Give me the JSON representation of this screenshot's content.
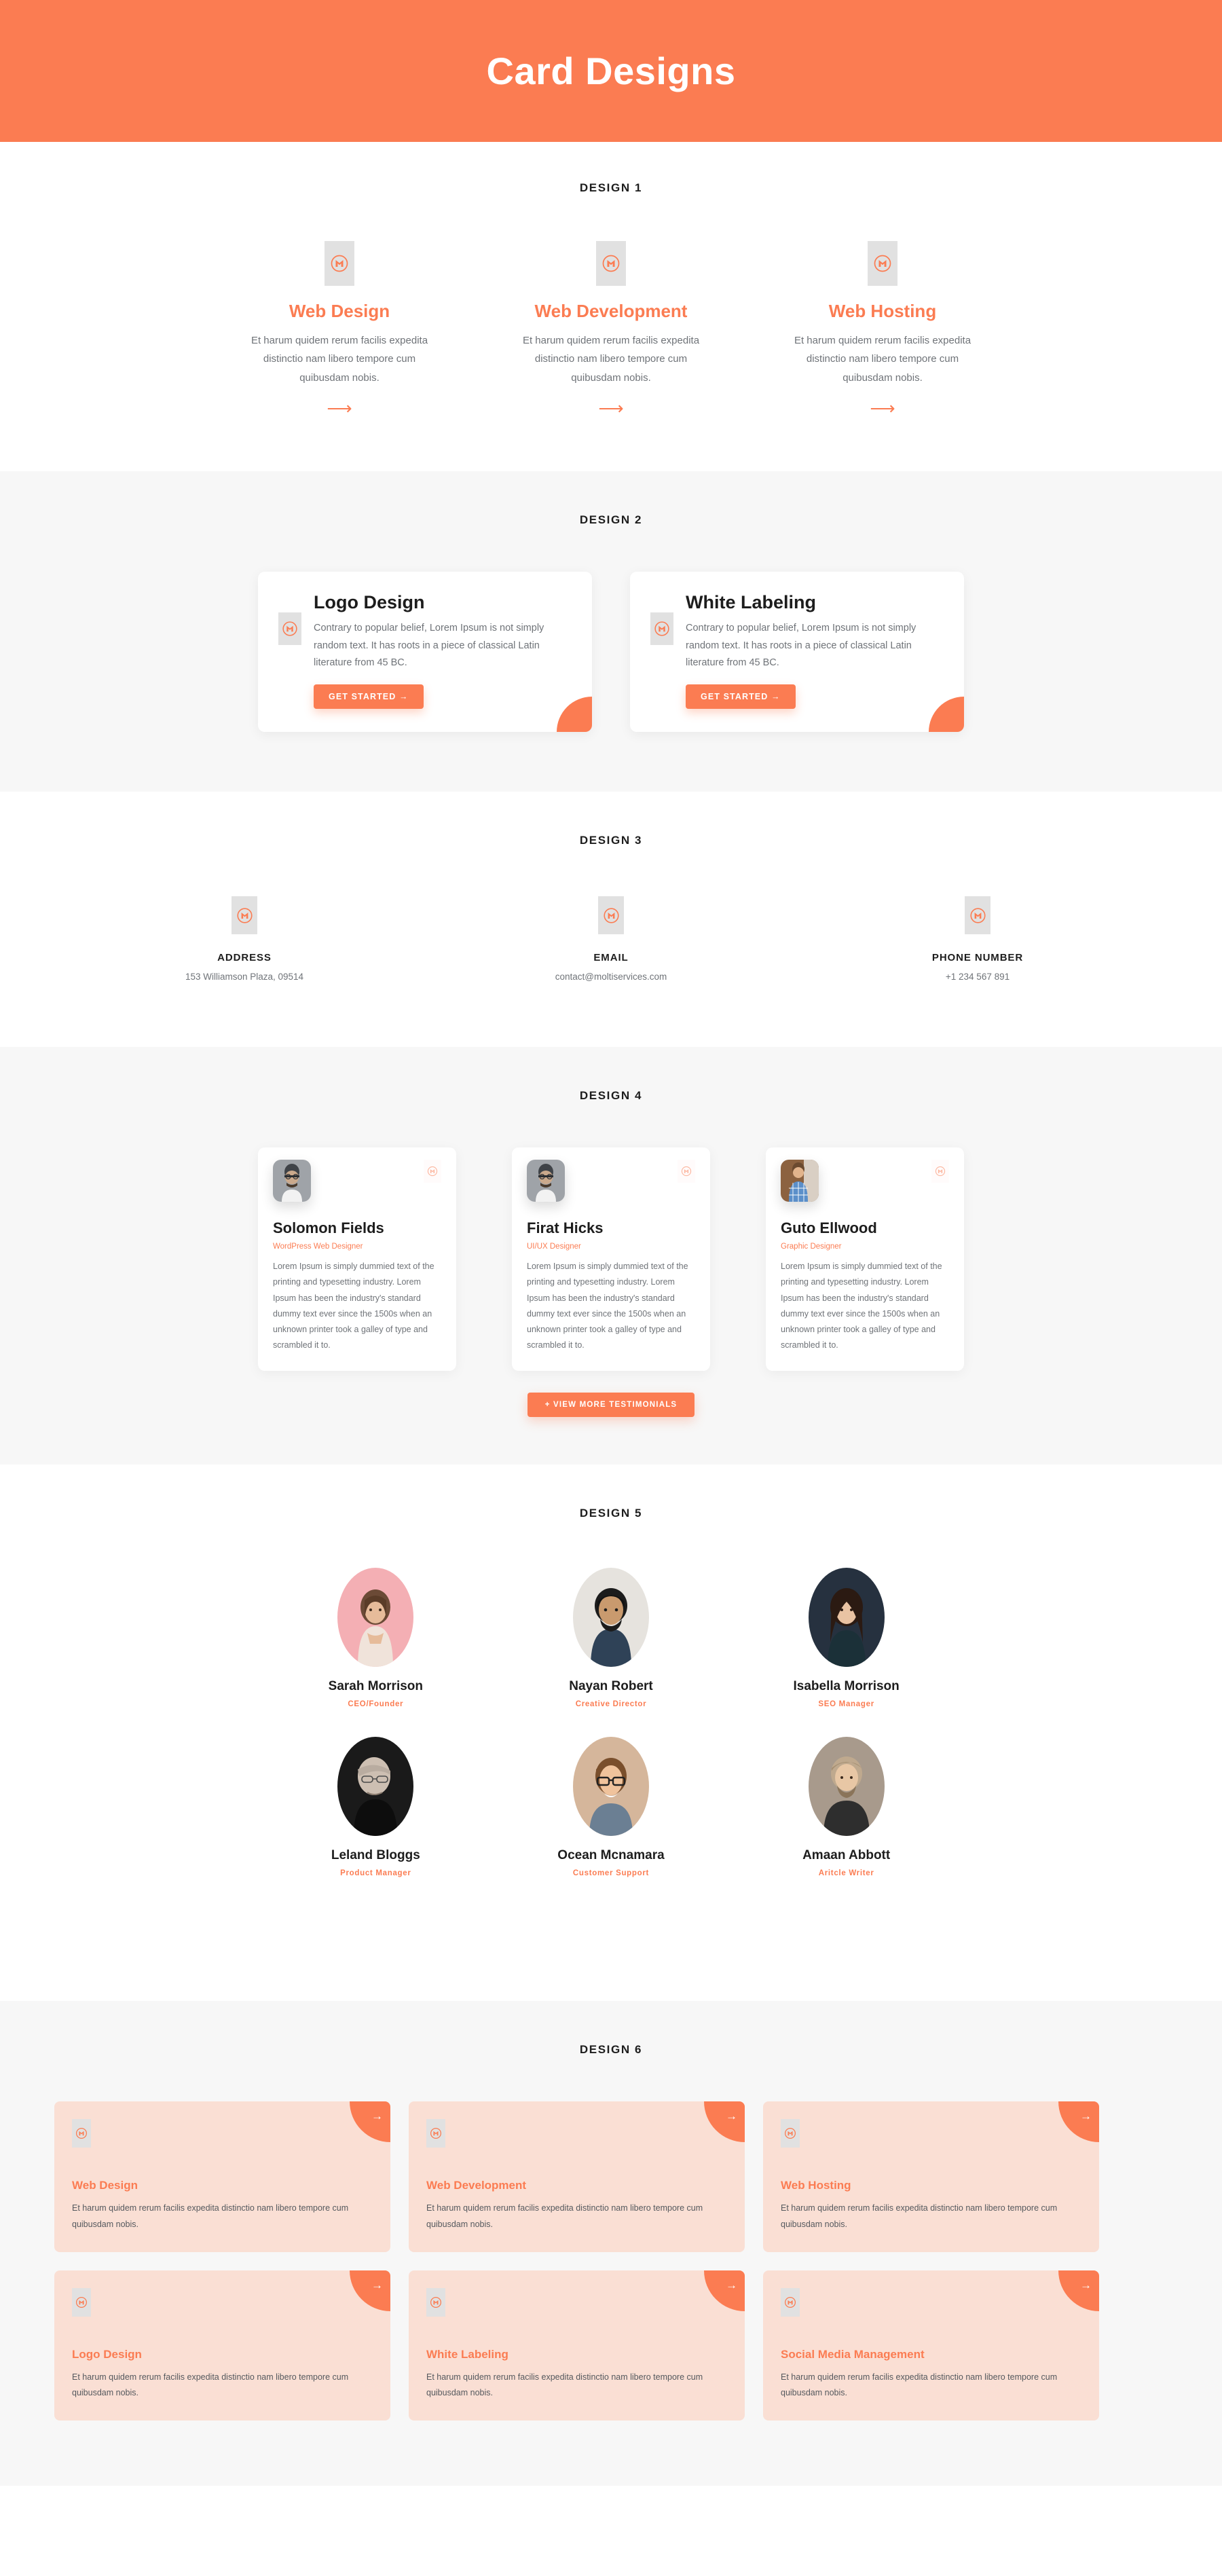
{
  "hero": {
    "title": "Card Designs",
    "bg_color": "#fb7c52"
  },
  "theme": {
    "accent": "#fb7c52",
    "section_gray": "#f7f7f7",
    "card_pink": "#fadfd4",
    "text_dark": "#1d1d1d",
    "text_muted": "#6f7378",
    "logo_placeholder": "#e1e1e1"
  },
  "design1": {
    "label": "DESIGN 1",
    "cards": [
      {
        "icon": "brand-m-logo-icon",
        "title": "Web Design",
        "desc": "Et harum quidem rerum facilis expedita distinctio nam libero tempore cum quibusdam nobis.",
        "arrow": "⟶"
      },
      {
        "icon": "brand-m-logo-icon",
        "title": "Web Development",
        "desc": "Et harum quidem rerum facilis expedita distinctio nam libero tempore cum quibusdam nobis.",
        "arrow": "⟶"
      },
      {
        "icon": "brand-m-logo-icon",
        "title": "Web Hosting",
        "desc": "Et harum quidem rerum facilis expedita distinctio nam libero tempore cum quibusdam nobis.",
        "arrow": "⟶"
      }
    ]
  },
  "design2": {
    "label": "DESIGN 2",
    "cards": [
      {
        "icon": "brand-m-logo-icon",
        "title": "Logo Design",
        "desc": "Contrary to popular belief, Lorem Ipsum is not simply random text. It has roots in a piece of classical Latin literature from 45 BC.",
        "button": "GET STARTED →"
      },
      {
        "icon": "brand-m-logo-icon",
        "title": "White Labeling",
        "desc": "Contrary to popular belief, Lorem Ipsum is not simply random text. It has roots in a piece of classical Latin literature from 45 BC.",
        "button": "GET STARTED →"
      }
    ]
  },
  "design3": {
    "label": "DESIGN 3",
    "cards": [
      {
        "icon": "brand-m-logo-icon",
        "label": "ADDRESS",
        "value": "153 Williamson Plaza, 09514"
      },
      {
        "icon": "brand-m-logo-icon",
        "label": "EMAIL",
        "value": "contact@moltiservices.com"
      },
      {
        "icon": "brand-m-logo-icon",
        "label": "PHONE NUMBER",
        "value": "+1 234 567 891"
      }
    ]
  },
  "design4": {
    "label": "DESIGN 4",
    "cta": "+ VIEW MORE TESTIMONIALS",
    "cards": [
      {
        "avatar": "avatar-photo",
        "watermark": "brand-m-logo-icon",
        "name": "Solomon Fields",
        "role": "WordPress Web Designer",
        "desc": "Lorem Ipsum is simply dummied text of the printing and typesetting industry. Lorem Ipsum has been the industry's standard dummy text ever since the 1500s when an unknown printer took a galley of type and scrambled it to."
      },
      {
        "avatar": "avatar-photo",
        "watermark": "brand-m-logo-icon",
        "name": "Firat Hicks",
        "role": "UI/UX Designer",
        "desc": "Lorem Ipsum is simply dummied text of the printing and typesetting industry. Lorem Ipsum has been the industry's standard dummy text ever since the 1500s when an unknown printer took a galley of type and scrambled it to."
      },
      {
        "avatar": "avatar-photo",
        "watermark": "brand-m-logo-icon",
        "name": "Guto Ellwood",
        "role": "Graphic Designer",
        "desc": "Lorem Ipsum is simply dummied text of the printing and typesetting industry. Lorem Ipsum has been the industry's standard dummy text ever since the 1500s when an unknown printer took a galley of type and scrambled it to."
      }
    ]
  },
  "design5": {
    "label": "DESIGN 5",
    "members": [
      {
        "photo": "avatar-photo",
        "name": "Sarah Morrison",
        "role": "CEO/Founder"
      },
      {
        "photo": "avatar-photo",
        "name": "Nayan Robert",
        "role": "Creative Director"
      },
      {
        "photo": "avatar-photo",
        "name": "Isabella Morrison",
        "role": "SEO Manager"
      },
      {
        "photo": "avatar-photo",
        "name": "Leland Bloggs",
        "role": "Product Manager"
      },
      {
        "photo": "avatar-photo",
        "name": "Ocean Mcnamara",
        "role": "Customer Support"
      },
      {
        "photo": "avatar-photo",
        "name": "Amaan Abbott",
        "role": "Aritcle Writer"
      }
    ]
  },
  "design6": {
    "label": "DESIGN 6",
    "cards": [
      {
        "icon": "brand-m-logo-icon",
        "arrow": "→",
        "title": "Web Design",
        "desc": "Et harum quidem rerum facilis expedita distinctio nam libero tempore cum quibusdam nobis."
      },
      {
        "icon": "brand-m-logo-icon",
        "arrow": "→",
        "title": "Web Development",
        "desc": "Et harum quidem rerum facilis expedita distinctio nam libero tempore cum quibusdam nobis."
      },
      {
        "icon": "brand-m-logo-icon",
        "arrow": "→",
        "title": "Web Hosting",
        "desc": "Et harum quidem rerum facilis expedita distinctio nam libero tempore cum quibusdam nobis."
      },
      {
        "icon": "brand-m-logo-icon",
        "arrow": "→",
        "title": "Logo Design",
        "desc": "Et harum quidem rerum facilis expedita distinctio nam libero tempore cum quibusdam nobis."
      },
      {
        "icon": "brand-m-logo-icon",
        "arrow": "→",
        "title": "White Labeling",
        "desc": "Et harum quidem rerum facilis expedita distinctio nam libero tempore cum quibusdam nobis."
      },
      {
        "icon": "brand-m-logo-icon",
        "arrow": "→",
        "title": "Social Media Management",
        "desc": "Et harum quidem rerum facilis expedita distinctio nam libero tempore cum quibusdam nobis."
      }
    ]
  }
}
